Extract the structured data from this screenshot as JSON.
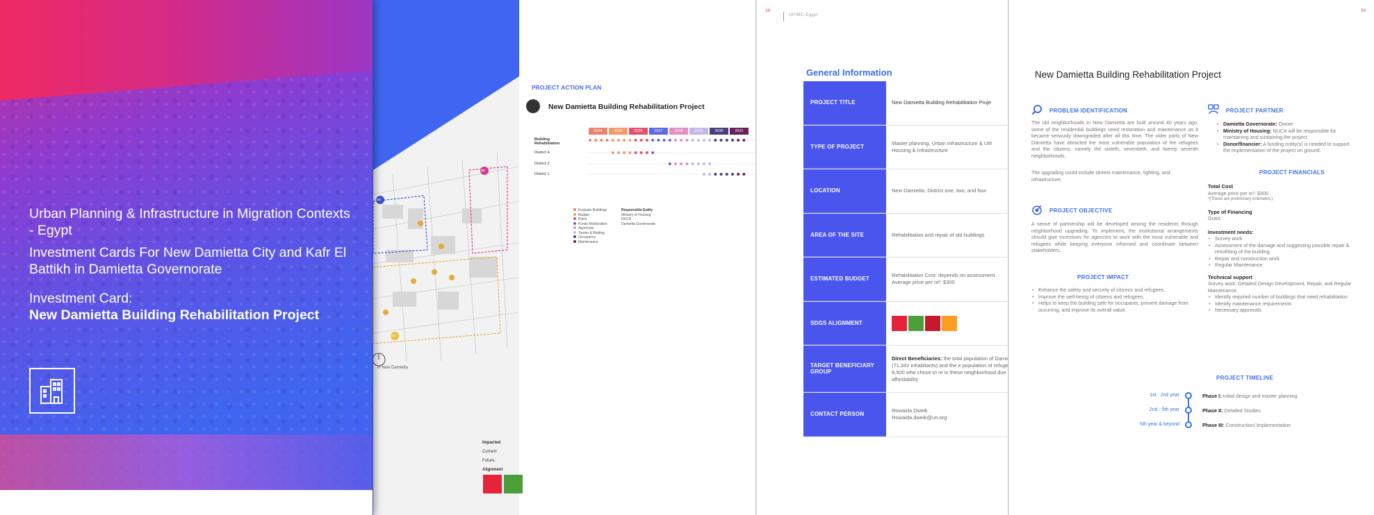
{
  "cover": {
    "line1": "Urban Planning & Infrastructure in Migration Contexts - Egypt",
    "line2": "Investment Cards For New Damietta City and Kafr El Battikh in Damietta Governorate",
    "line3": "Investment Card:",
    "line4": "New Damietta Building Rehabilitation Project",
    "icon": "building-icon"
  },
  "map": {
    "markers": [
      "D3",
      "D2",
      "D4"
    ],
    "caption": "in New Damietta"
  },
  "plan": {
    "heading": "PROJECT ACTION PLAN",
    "title": "New Damietta Building Rehabilitation Project",
    "years": [
      "2024",
      "2025",
      "2026",
      "2027",
      "2028",
      "2029",
      "2030",
      "2031"
    ],
    "year_colors": [
      "#e9826f",
      "#ef9a6a",
      "#e3516e",
      "#5a69e5",
      "#e48fc1",
      "#c4b6e9",
      "#4a3f7e",
      "#6a1f5a"
    ],
    "rows": [
      "Building Rehabilitation",
      "District 4",
      "District 3",
      "District 1"
    ],
    "legend": [
      "Evaluate Buildings",
      "Budget",
      "Plans",
      "Funds Mobilization",
      "Approvals",
      "Tender & Bidding",
      "Occupancy",
      "Maintenance"
    ],
    "entity_label": "Responsible Entity",
    "entities": [
      "Ministry of Housing",
      "NUCA",
      "Damietta Governorate"
    ],
    "impacted_lines": [
      "Impacted",
      "Current:",
      "Future:",
      "Alignment"
    ]
  },
  "general": {
    "page_number": "38",
    "header": "UPIMC-Egypt",
    "title": "General Information",
    "rows": [
      {
        "key": "PROJECT TITLE",
        "value": "New Damietta Building Rehabilitation Proje"
      },
      {
        "key": "TYPE OF PROJECT",
        "value": "Master planning, Urban infrastructure & Uth\nHousing & Infrastructure"
      },
      {
        "key": "LOCATION",
        "value": "New Damietta, District one, two, and four"
      },
      {
        "key": "AREA OF THE SITE",
        "value": "Rehabilitation and repair of old buildings"
      },
      {
        "key": "ESTIMATED BUDGET",
        "value": "Rehabilitation Cost: depends on assessment\nAverage price per m²: $300"
      },
      {
        "key": "SDGS ALIGNMENT",
        "value": ""
      },
      {
        "key": "TARGET BENEFICIARY GROUP",
        "value_bold": "Direct Beneficiaries:",
        "value": " the total population of Damietta (71,342 inhabitants) and the e population of refugees 9,500 who chose to re in these neighborhood due to its affordability"
      },
      {
        "key": "CONTACT PERSON",
        "value": "Rowaida Dweik\nRowaida.dweik@un.org"
      }
    ],
    "sdg_colors": [
      "#e5243b",
      "#4c9f38",
      "#c5192d",
      "#fd9d24"
    ]
  },
  "project": {
    "page_number": "39",
    "title": "New Damietta Building Rehabilitation Project",
    "problem_heading": "PROBLEM IDENTIFICATION",
    "problem_text": "The old neighborhoods in New Damietta are built around 40 years ago, some of the residential buildings need restoration and maintenance as it became seriously downgraded after all this time. The older parts of New Damietta have attracted the most vulnerable population of the refugees and the citizens, namely the sixteth, seventieth, and twenty seventh neighborhoods.",
    "problem_text2": "The upgrading could include streets maintenance, lighting, and infrastructure.",
    "objective_heading": "PROJECT OBJECTIVE",
    "objective_text": "A sense of partnership will be developed among the residents through neighborhood upgrading. To implement, the institutional arrangements should give incentives for agencies to work with the most vulnerable and refugees while keeping everyone informed and coordinate between stakeholders.",
    "impact_heading": "PROJECT IMPACT",
    "impacts": [
      "Enhance the safety and security of citizens and refugees.",
      "Improve the well-being of citizens and refugees.",
      "Helps to keep the building safe for occupants, prevent damage from occurring, and improve its overall value."
    ],
    "partner_heading": "PROJECT PARTNER",
    "partners": [
      {
        "bold": "Damietta Governorate:",
        "text": " Owner"
      },
      {
        "bold": "Ministry of Housing:",
        "text": " NUCA will be responsible for maintaining and sustaining the project."
      },
      {
        "bold": "Donor/financier:",
        "text": " A funding entity(s) is needed to support the implementation of the project on ground."
      }
    ],
    "financials_heading": "PROJECT FINANCIALS",
    "total_cost_label": "Total Cost",
    "total_cost": "Average price per m²: $300",
    "total_cost_note": "*(These are preliminary estimates.)",
    "financing_label": "Type of Financing",
    "financing": "Grant",
    "needs_label": "Investment needs:",
    "needs": [
      "Survey work",
      "Assessment of the damage and suggesting possible repair & retrofitting of the building.",
      "Repair and construction work",
      "Regular Maintenance"
    ],
    "support_label": "Technical support",
    "support_text": "Survey work, Detailed Design Development, Repair, and Regular Maintenance.",
    "support_items": [
      "Identify required number of buildings that need rehabilitation",
      "Identify maintenance requirements",
      "Necessary approvals"
    ],
    "timeline_heading": "PROJECT TIMELINE",
    "phases": [
      {
        "when": "1st - 2nd year",
        "bold": "Phase I:",
        "text": " Initial design and master planning"
      },
      {
        "when": "2nd - 5th year",
        "bold": "Phase II:",
        "text": " Detailed Studies"
      },
      {
        "when": "5th year & beyond",
        "bold": "Phase III:",
        "text": " Construction/ Implementation"
      }
    ]
  }
}
